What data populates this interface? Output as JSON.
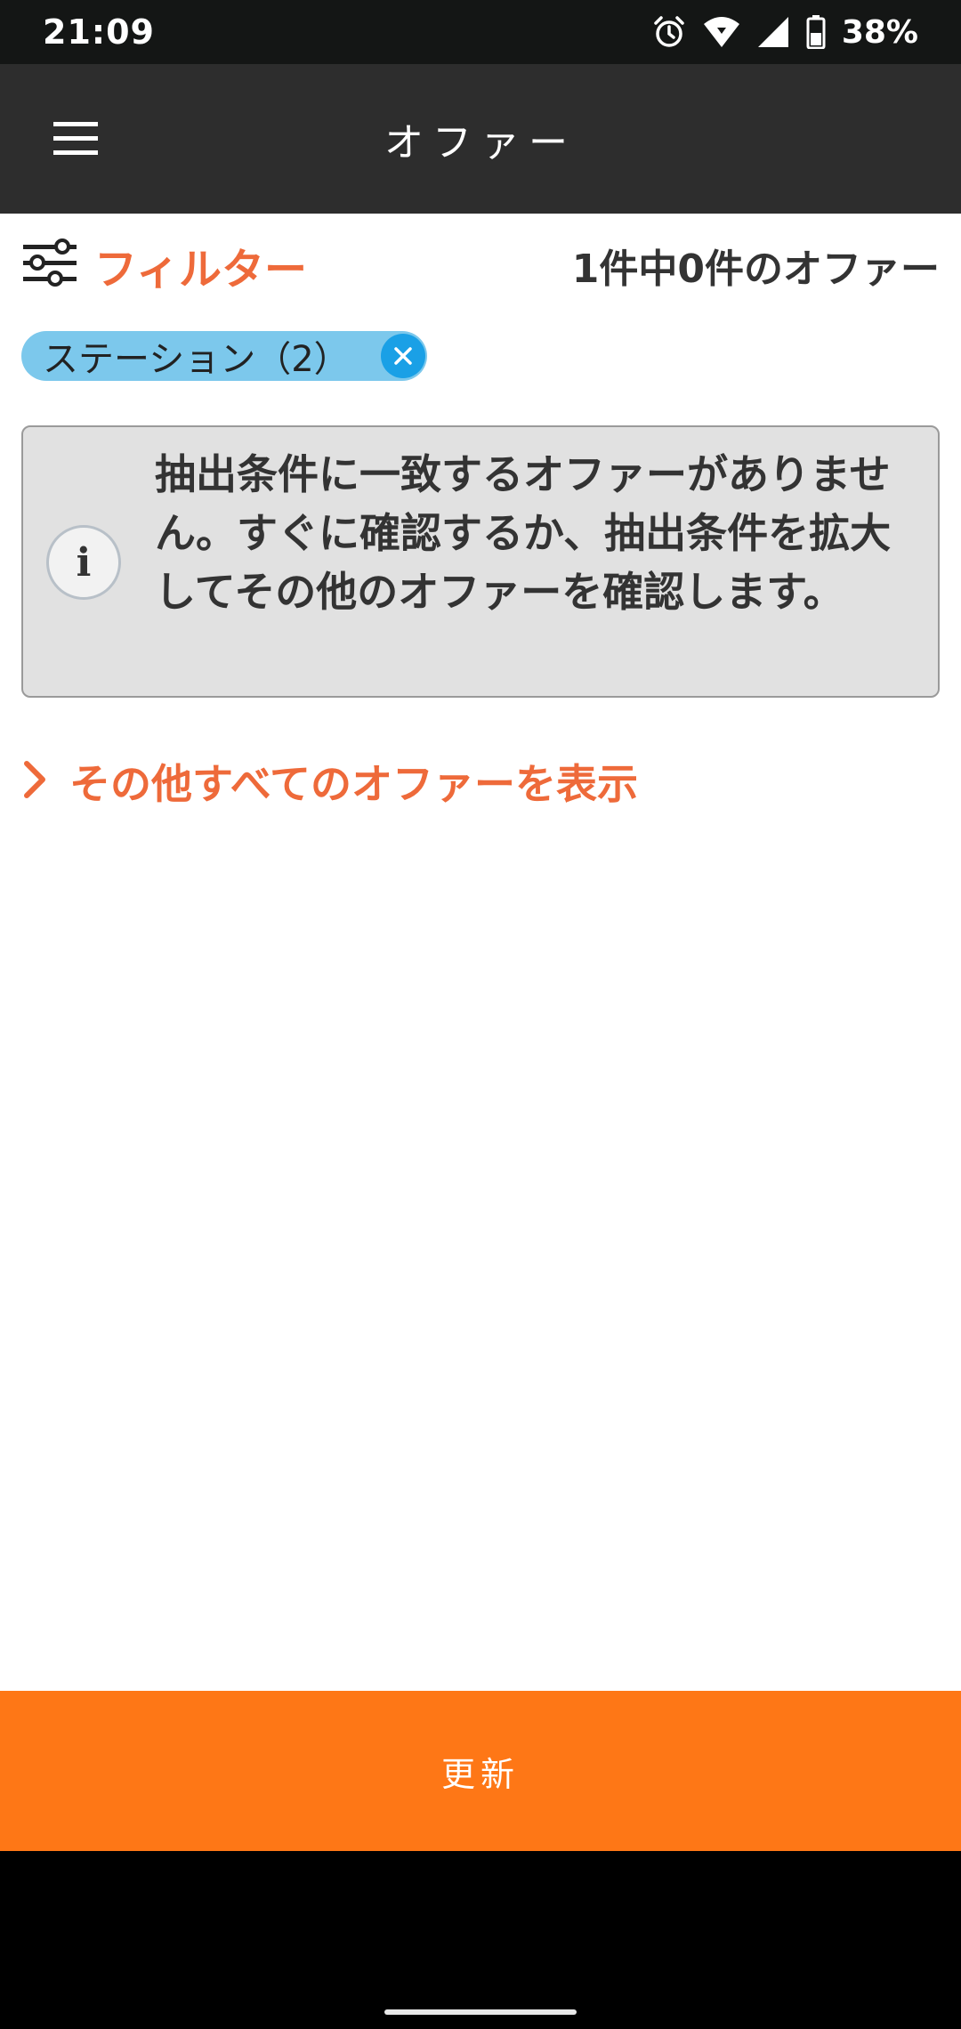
{
  "status_bar": {
    "time": "21:09",
    "battery": "38%",
    "icons": [
      "alarm-icon",
      "wifi-icon",
      "signal-icon",
      "battery-icon"
    ]
  },
  "app_bar": {
    "title": "オファー",
    "menu_icon": "hamburger-menu-icon"
  },
  "filter": {
    "label": "フィルター",
    "icon": "sliders-icon",
    "offer_count": "1件中0件のオファー"
  },
  "chip": {
    "label": "ステーション（2）",
    "close_icon": "close-icon"
  },
  "info": {
    "icon": "info-icon",
    "message": "抽出条件に一致するオファーがありません。すぐに確認するか、抽出条件を拡大してその他のオファーを確認します。"
  },
  "show_all": {
    "label": "その他すべてのオファーを表示",
    "icon": "chevron-right-icon"
  },
  "refresh": {
    "label": "更新"
  },
  "colors": {
    "accent": "#ee6a3a",
    "refresh_button": "#fe7716",
    "chip": "#7cc8ec",
    "chip_close": "#1aa0e6",
    "app_bar": "#2d2d2d"
  }
}
